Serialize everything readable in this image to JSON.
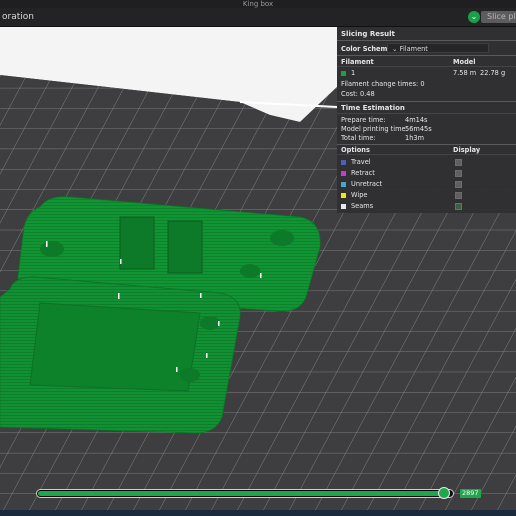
{
  "window": {
    "title": "King box"
  },
  "toolbar": {
    "tab_label": "oration",
    "slice_button_label": "Slice pla",
    "toggle_icon": "chevron-down-icon"
  },
  "slicing_result": {
    "title": "Slicing Result",
    "color_scheme_label": "Color Scheme",
    "color_scheme_value": "Filament",
    "filament_header": "Filament",
    "model_header": "Model",
    "filament": {
      "index": "1",
      "color": "#19a049",
      "length": "7.58 m",
      "weight": "22.78 g"
    },
    "change_times_label": "Filament change times:",
    "change_times_value": "0",
    "cost_label": "Cost:",
    "cost_value": "0.48",
    "time_estimation_title": "Time Estimation",
    "prepare_label": "Prepare time:",
    "prepare_value": "4m14s",
    "model_printing_label": "Model printing time:",
    "model_printing_value": "56m45s",
    "total_label": "Total time:",
    "total_value": "1h3m",
    "options_header": "Options",
    "display_header": "Display",
    "options": [
      {
        "label": "Travel",
        "color": "#4b5ebe",
        "checked": false
      },
      {
        "label": "Retract",
        "color": "#c83bc8",
        "checked": false
      },
      {
        "label": "Unretract",
        "color": "#3fa7d6",
        "checked": false
      },
      {
        "label": "Wipe",
        "color": "#f2e60a",
        "checked": false
      },
      {
        "label": "Seams",
        "color": "#e8e8e8",
        "checked": true
      }
    ]
  },
  "layer_slider": {
    "value": "2897",
    "fill_fraction": 0.99
  },
  "colors": {
    "accent": "#19a049",
    "model_green": "#0e8a2e",
    "panel_bg": "#303032"
  }
}
